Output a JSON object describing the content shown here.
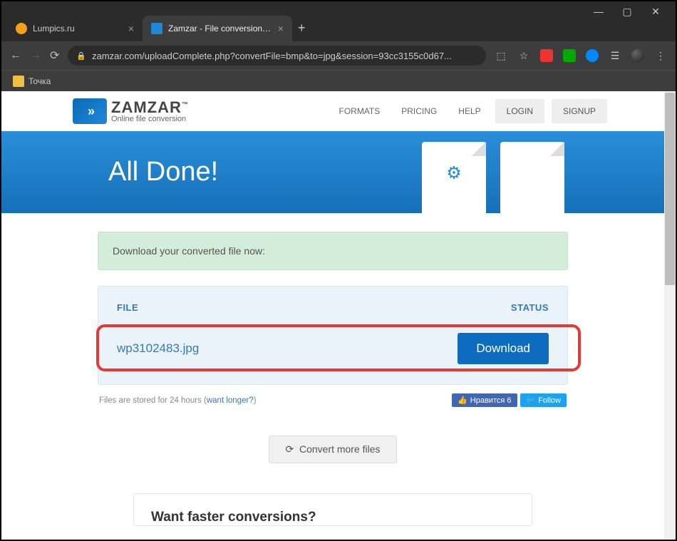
{
  "browser": {
    "tabs": [
      {
        "title": "Lumpics.ru",
        "active": false
      },
      {
        "title": "Zamzar - File conversion progres",
        "active": true
      }
    ],
    "url": "zamzar.com/uploadComplete.php?convertFile=bmp&to=jpg&session=93cc3155c0d67...",
    "bookmark_label": "Точка"
  },
  "header": {
    "brand": "ZAMZAR",
    "trademark": "™",
    "tagline": "Online file conversion",
    "nav": {
      "formats": "FORMATS",
      "pricing": "PRICING",
      "help": "HELP",
      "login": "LOGIN",
      "signup": "SIGNUP"
    }
  },
  "hero": {
    "title": "All Done!"
  },
  "alert": {
    "text": "Download your converted file now:"
  },
  "panel": {
    "col_file": "FILE",
    "col_status": "STATUS",
    "filename": "wp3102483.jpg",
    "download_btn": "Download"
  },
  "foot": {
    "stored_prefix": "Files are stored for 24 hours (",
    "stored_link": "want longer?",
    "stored_suffix": ")",
    "fb_like": "Нравится 6",
    "tw_follow": "Follow"
  },
  "convert_more": "Convert more files",
  "faster": {
    "heading": "Want faster conversions?"
  }
}
